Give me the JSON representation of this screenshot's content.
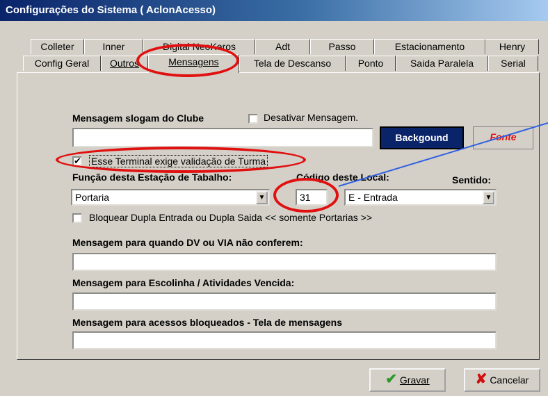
{
  "window": {
    "title": "Configurações do Sistema ( AclonAcesso)"
  },
  "tabs_row1": [
    "Colleter",
    "Inner",
    "Digital NeoKeros",
    "Adt",
    "Passo",
    "Estacionamento",
    "Henry"
  ],
  "tabs_row2": [
    "Config Geral",
    "Outros",
    "Mensagens",
    "Tela de Descanso",
    "Ponto",
    "Saida Paralela",
    "Serial"
  ],
  "slogan": {
    "label": "Mensagem slogam do Clube",
    "disable_label": "Desativar Mensagem.",
    "value": "",
    "background_button": "Backgound",
    "font_button": "Fonte"
  },
  "turma_validation": {
    "label": "Esse Terminal exige validação de Turma",
    "checked": "✔"
  },
  "workstation": {
    "function_label": "Função desta Estação de Tabalho:",
    "function_value": "Portaria",
    "location_code_label": "Código deste Local:",
    "location_code_value": "31",
    "direction_label": "Sentido:",
    "direction_value": "E - Entrada"
  },
  "block_double": {
    "label": "Bloquear Dupla Entrada ou Dupla Saida << somente Portarias >>"
  },
  "messages": {
    "dv_via_label": "Mensagem para quando DV ou VIA não conferem:",
    "dv_via_value": "",
    "school_label": "Mensagem para Escolinha / Atividades Vencida:",
    "school_value": "",
    "blocked_label": "Mensagem para acessos bloqueados - Tela de mensagens",
    "blocked_value": ""
  },
  "footer": {
    "save_label": "Gravar",
    "cancel_label": "Cancelar"
  },
  "colors": {
    "title_bar": "#0a246a",
    "background_button": "#0a246a",
    "annotation": "#e01010",
    "pointer_line": "#3060e0"
  }
}
